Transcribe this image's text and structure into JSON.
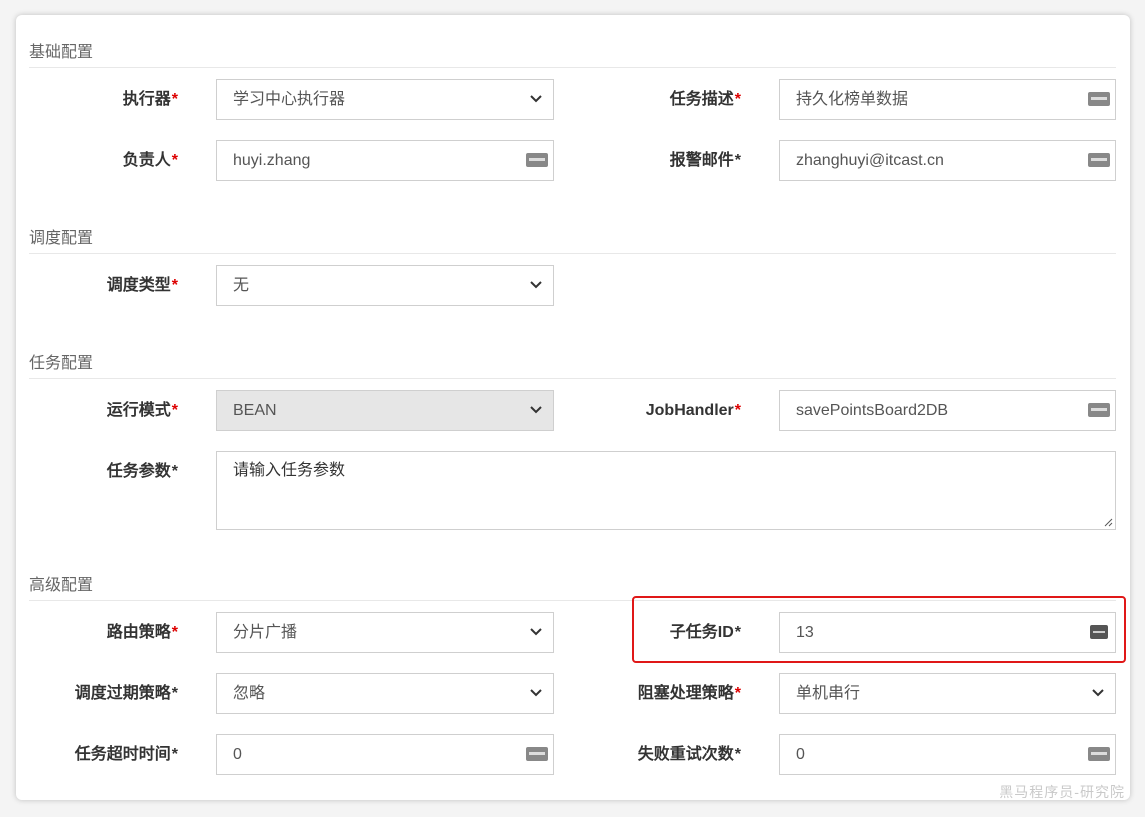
{
  "sections": {
    "basic": "基础配置",
    "schedule": "调度配置",
    "task": "任务配置",
    "advanced": "高级配置"
  },
  "required_mark": "*",
  "fields": {
    "executor": {
      "label": "执行器",
      "value": "学习中心执行器",
      "type": "select"
    },
    "job_desc": {
      "label": "任务描述",
      "value": "持久化榜单数据",
      "type": "text"
    },
    "author": {
      "label": "负责人",
      "value": "huyi.zhang",
      "type": "text"
    },
    "alarm_email": {
      "label": "报警邮件",
      "value": "zhanghuyi@itcast.cn",
      "type": "text"
    },
    "schedule_type": {
      "label": "调度类型",
      "value": "无",
      "type": "select"
    },
    "run_mode": {
      "label": "运行模式",
      "value": "BEAN",
      "type": "select",
      "disabled": true
    },
    "job_handler": {
      "label": "JobHandler",
      "value": "savePointsBoard2DB",
      "type": "text"
    },
    "job_param": {
      "label": "任务参数",
      "placeholder": "请输入任务参数",
      "type": "textarea"
    },
    "route_strategy": {
      "label": "路由策略",
      "value": "分片广播",
      "type": "select"
    },
    "child_job_id": {
      "label": "子任务ID",
      "value": "13",
      "type": "text"
    },
    "misfire_strategy": {
      "label": "调度过期策略",
      "value": "忽略",
      "type": "select"
    },
    "block_strategy": {
      "label": "阻塞处理策略",
      "value": "单机串行",
      "type": "select"
    },
    "timeout": {
      "label": "任务超时时间",
      "value": "0",
      "type": "text"
    },
    "fail_retry": {
      "label": "失败重试次数",
      "value": "0",
      "type": "text"
    }
  },
  "icons": {
    "select": "chevron-down-icon",
    "text": "keyboard-icon"
  },
  "colors": {
    "required": "#dd0000",
    "highlight": "#e01818",
    "disabled_bg": "#e6e6e6"
  },
  "watermark": "黑马程序员-研究院"
}
